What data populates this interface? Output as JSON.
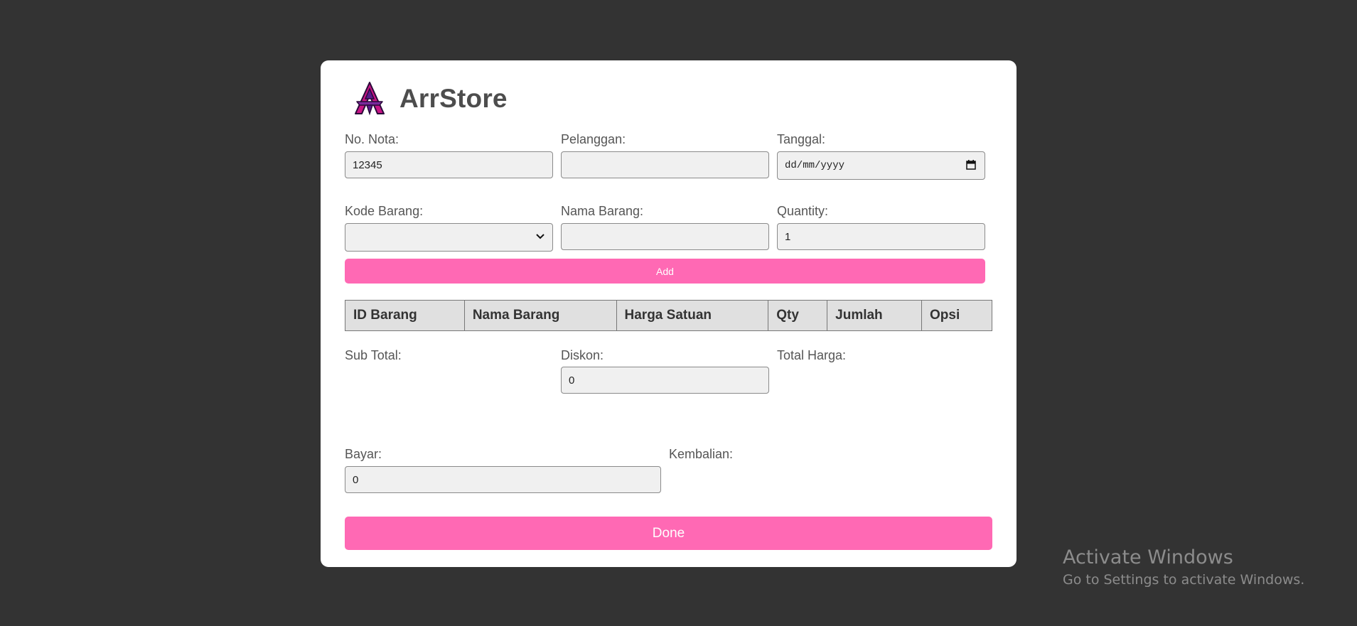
{
  "brand": {
    "title": "ArrStore",
    "logo_icon": "arrstore-logo-icon",
    "logo_colors": [
      "#c71585",
      "#5a1a8c"
    ]
  },
  "form": {
    "no_nota": {
      "label": "No. Nota:",
      "value": "12345"
    },
    "pelanggan": {
      "label": "Pelanggan:",
      "value": ""
    },
    "tanggal": {
      "label": "Tanggal:",
      "value": "dd/mm/yyyy",
      "icon": "calendar-icon"
    },
    "kode_barang": {
      "label": "Kode Barang:",
      "value": "",
      "icon": "chevron-down-icon"
    },
    "nama_barang": {
      "label": "Nama Barang:",
      "value": ""
    },
    "quantity": {
      "label": "Quantity:",
      "value": "1"
    },
    "add_label": "Add"
  },
  "table": {
    "headers": [
      "ID Barang",
      "Nama Barang",
      "Harga Satuan",
      "Qty",
      "Jumlah",
      "Opsi"
    ],
    "rows": []
  },
  "summary": {
    "sub_total": {
      "label": "Sub Total:",
      "value": ""
    },
    "diskon": {
      "label": "Diskon:",
      "value": "0"
    },
    "total_harga": {
      "label": "Total Harga:",
      "value": ""
    },
    "bayar": {
      "label": "Bayar:",
      "value": "0"
    },
    "kembalian": {
      "label": "Kembalian:",
      "value": ""
    }
  },
  "done_label": "Done",
  "watermark": {
    "title": "Activate Windows",
    "subtitle": "Go to Settings to activate Windows."
  },
  "colors": {
    "background": "#333333",
    "card": "#ffffff",
    "accent": "#ff69b4",
    "input_bg": "#f0f0f0",
    "table_header_bg": "#e0e0e0"
  }
}
